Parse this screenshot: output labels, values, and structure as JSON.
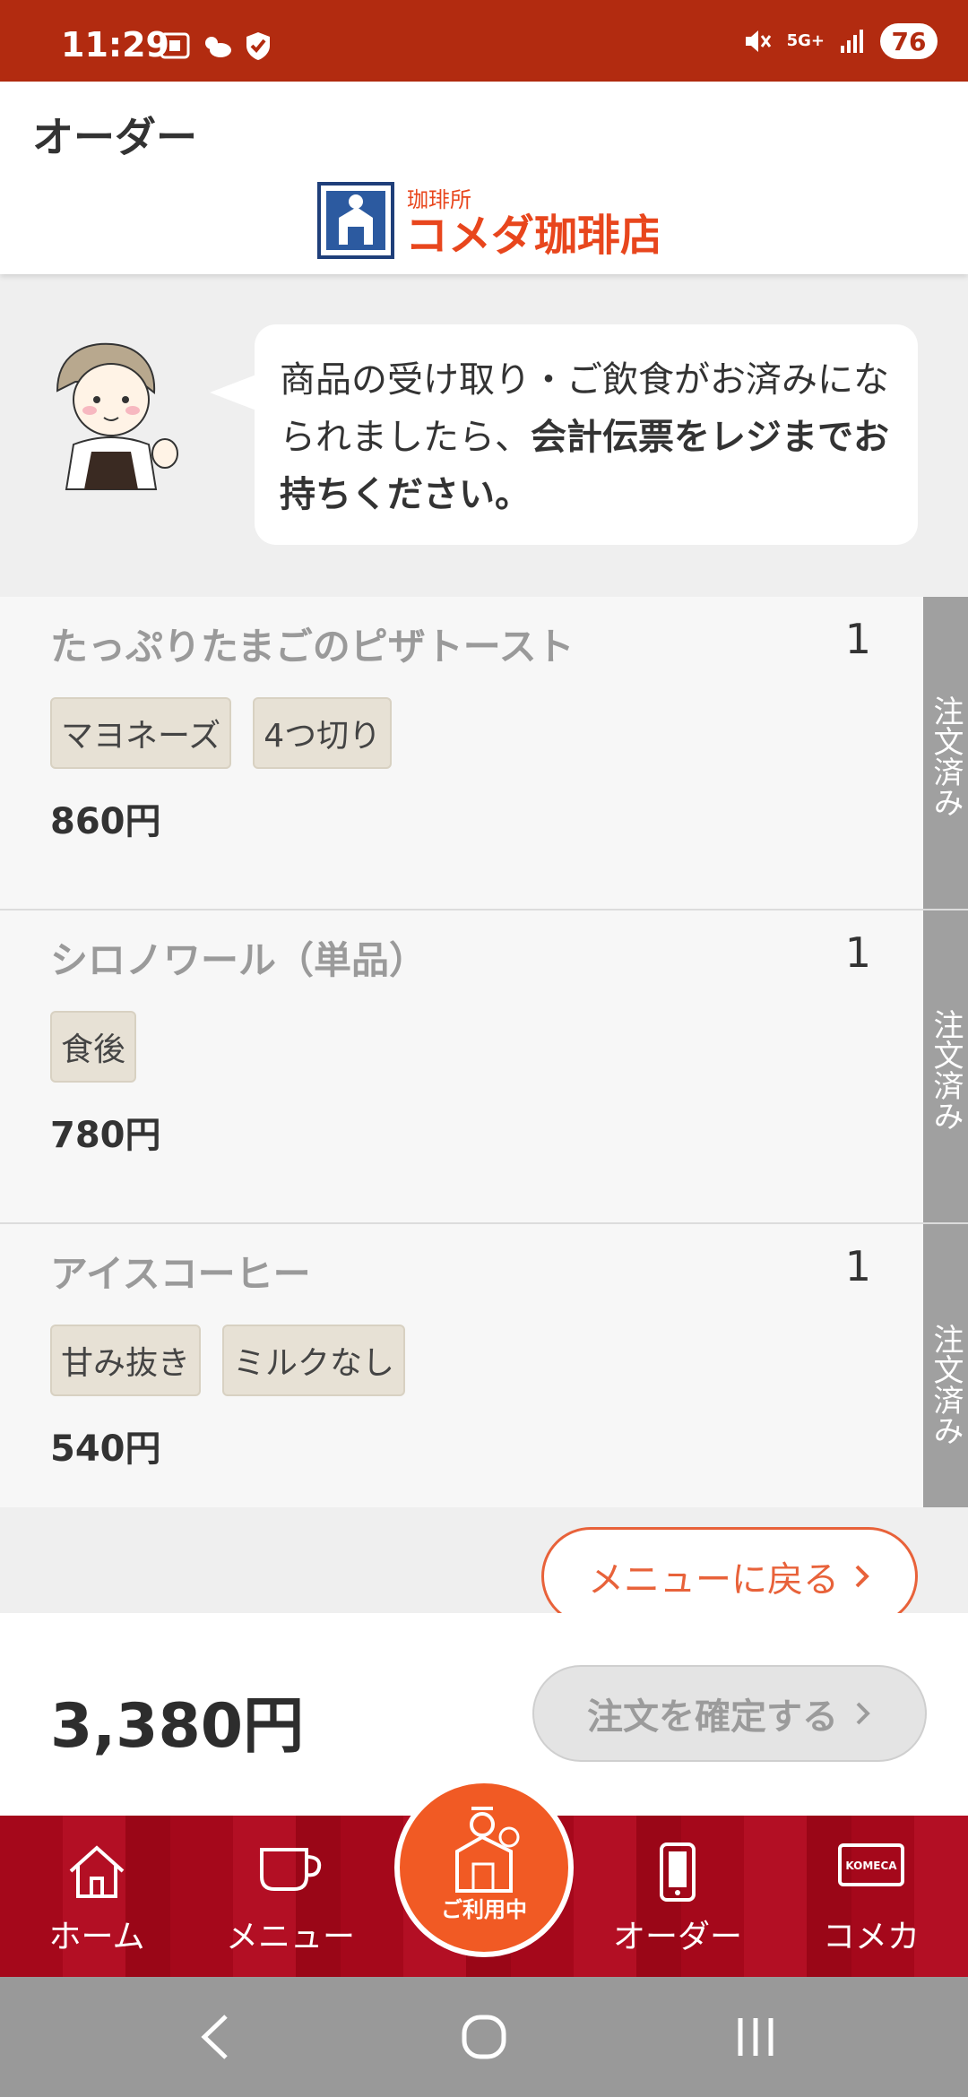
{
  "status_bar": {
    "time": "11:29",
    "network": "5G+",
    "battery": "76"
  },
  "header": {
    "title": "オーダー",
    "logo_text": "コメダ珈琲店",
    "logo_small": "珈琲所"
  },
  "notice": {
    "text_plain": "商品の受け取り・ご飲食がお済みになられましたら、",
    "text_bold": "会計伝票をレジまでお持ちください。"
  },
  "orders": [
    {
      "name": "たっぷりたまごのピザトースト",
      "qty": "1",
      "options": [
        "マヨネーズ",
        "4つ切り"
      ],
      "price": "860円",
      "status": "注文済み"
    },
    {
      "name": "シロノワール（単品）",
      "qty": "1",
      "options": [
        "食後"
      ],
      "price": "780円",
      "status": "注文済み"
    },
    {
      "name": "アイスコーヒー",
      "qty": "1",
      "options": [
        "甘み抜き",
        "ミルクなし"
      ],
      "price": "540円",
      "status": "注文済み"
    }
  ],
  "back_button": "メニューに戻る",
  "total": "3,380円",
  "confirm_button": "注文を確定する",
  "nav": {
    "home": "ホーム",
    "menu": "メニュー",
    "in_use": "ご利用中",
    "order": "オーダー",
    "komeca": "コメカ",
    "komeca_card": "KOMECA"
  },
  "colors": {
    "brand_red": "#b22b10",
    "accent_orange": "#e8623a",
    "nav_red": "#a5081b"
  }
}
